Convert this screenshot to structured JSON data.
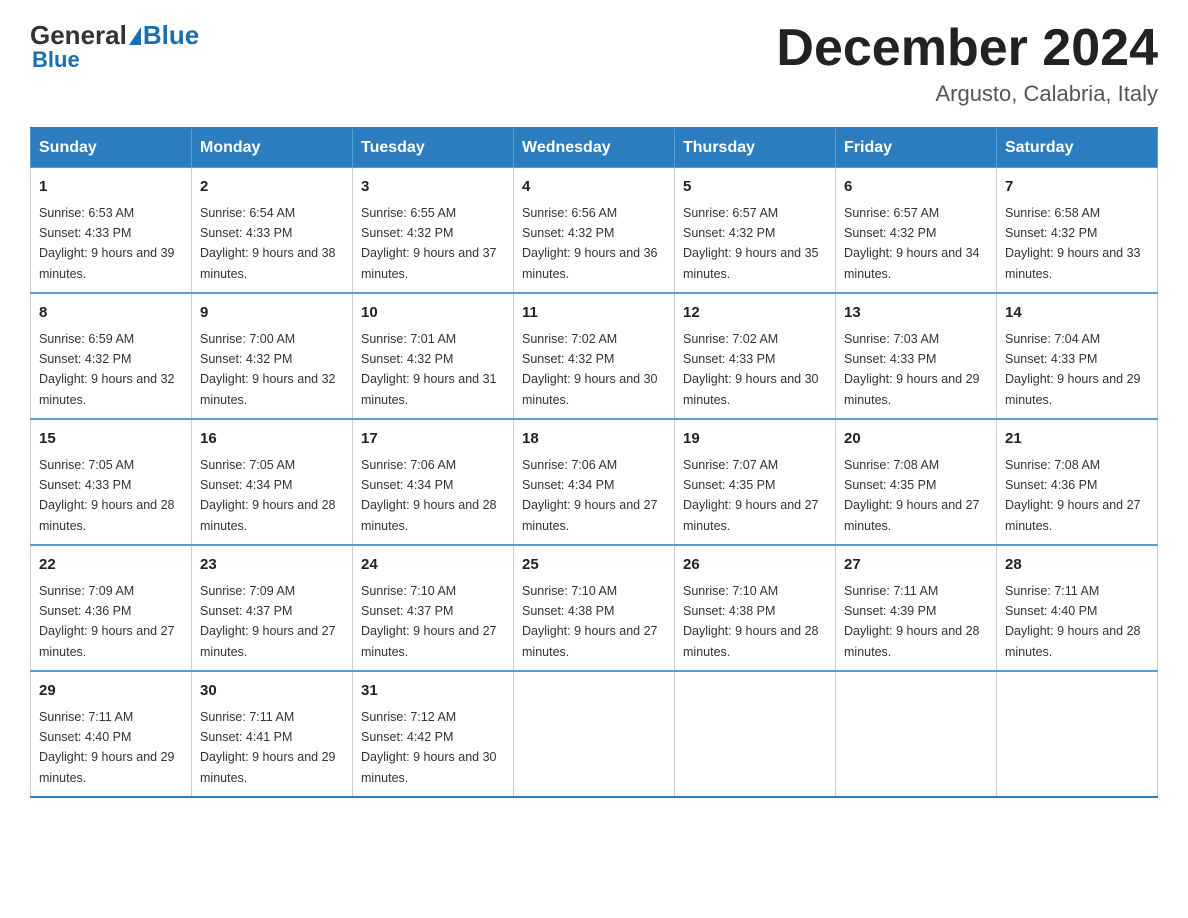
{
  "header": {
    "logo_general": "General",
    "logo_blue": "Blue",
    "month_title": "December 2024",
    "location": "Argusto, Calabria, Italy"
  },
  "days_of_week": [
    "Sunday",
    "Monday",
    "Tuesday",
    "Wednesday",
    "Thursday",
    "Friday",
    "Saturday"
  ],
  "weeks": [
    [
      {
        "day": "1",
        "sunrise": "6:53 AM",
        "sunset": "4:33 PM",
        "daylight": "9 hours and 39 minutes."
      },
      {
        "day": "2",
        "sunrise": "6:54 AM",
        "sunset": "4:33 PM",
        "daylight": "9 hours and 38 minutes."
      },
      {
        "day": "3",
        "sunrise": "6:55 AM",
        "sunset": "4:32 PM",
        "daylight": "9 hours and 37 minutes."
      },
      {
        "day": "4",
        "sunrise": "6:56 AM",
        "sunset": "4:32 PM",
        "daylight": "9 hours and 36 minutes."
      },
      {
        "day": "5",
        "sunrise": "6:57 AM",
        "sunset": "4:32 PM",
        "daylight": "9 hours and 35 minutes."
      },
      {
        "day": "6",
        "sunrise": "6:57 AM",
        "sunset": "4:32 PM",
        "daylight": "9 hours and 34 minutes."
      },
      {
        "day": "7",
        "sunrise": "6:58 AM",
        "sunset": "4:32 PM",
        "daylight": "9 hours and 33 minutes."
      }
    ],
    [
      {
        "day": "8",
        "sunrise": "6:59 AM",
        "sunset": "4:32 PM",
        "daylight": "9 hours and 32 minutes."
      },
      {
        "day": "9",
        "sunrise": "7:00 AM",
        "sunset": "4:32 PM",
        "daylight": "9 hours and 32 minutes."
      },
      {
        "day": "10",
        "sunrise": "7:01 AM",
        "sunset": "4:32 PM",
        "daylight": "9 hours and 31 minutes."
      },
      {
        "day": "11",
        "sunrise": "7:02 AM",
        "sunset": "4:32 PM",
        "daylight": "9 hours and 30 minutes."
      },
      {
        "day": "12",
        "sunrise": "7:02 AM",
        "sunset": "4:33 PM",
        "daylight": "9 hours and 30 minutes."
      },
      {
        "day": "13",
        "sunrise": "7:03 AM",
        "sunset": "4:33 PM",
        "daylight": "9 hours and 29 minutes."
      },
      {
        "day": "14",
        "sunrise": "7:04 AM",
        "sunset": "4:33 PM",
        "daylight": "9 hours and 29 minutes."
      }
    ],
    [
      {
        "day": "15",
        "sunrise": "7:05 AM",
        "sunset": "4:33 PM",
        "daylight": "9 hours and 28 minutes."
      },
      {
        "day": "16",
        "sunrise": "7:05 AM",
        "sunset": "4:34 PM",
        "daylight": "9 hours and 28 minutes."
      },
      {
        "day": "17",
        "sunrise": "7:06 AM",
        "sunset": "4:34 PM",
        "daylight": "9 hours and 28 minutes."
      },
      {
        "day": "18",
        "sunrise": "7:06 AM",
        "sunset": "4:34 PM",
        "daylight": "9 hours and 27 minutes."
      },
      {
        "day": "19",
        "sunrise": "7:07 AM",
        "sunset": "4:35 PM",
        "daylight": "9 hours and 27 minutes."
      },
      {
        "day": "20",
        "sunrise": "7:08 AM",
        "sunset": "4:35 PM",
        "daylight": "9 hours and 27 minutes."
      },
      {
        "day": "21",
        "sunrise": "7:08 AM",
        "sunset": "4:36 PM",
        "daylight": "9 hours and 27 minutes."
      }
    ],
    [
      {
        "day": "22",
        "sunrise": "7:09 AM",
        "sunset": "4:36 PM",
        "daylight": "9 hours and 27 minutes."
      },
      {
        "day": "23",
        "sunrise": "7:09 AM",
        "sunset": "4:37 PM",
        "daylight": "9 hours and 27 minutes."
      },
      {
        "day": "24",
        "sunrise": "7:10 AM",
        "sunset": "4:37 PM",
        "daylight": "9 hours and 27 minutes."
      },
      {
        "day": "25",
        "sunrise": "7:10 AM",
        "sunset": "4:38 PM",
        "daylight": "9 hours and 27 minutes."
      },
      {
        "day": "26",
        "sunrise": "7:10 AM",
        "sunset": "4:38 PM",
        "daylight": "9 hours and 28 minutes."
      },
      {
        "day": "27",
        "sunrise": "7:11 AM",
        "sunset": "4:39 PM",
        "daylight": "9 hours and 28 minutes."
      },
      {
        "day": "28",
        "sunrise": "7:11 AM",
        "sunset": "4:40 PM",
        "daylight": "9 hours and 28 minutes."
      }
    ],
    [
      {
        "day": "29",
        "sunrise": "7:11 AM",
        "sunset": "4:40 PM",
        "daylight": "9 hours and 29 minutes."
      },
      {
        "day": "30",
        "sunrise": "7:11 AM",
        "sunset": "4:41 PM",
        "daylight": "9 hours and 29 minutes."
      },
      {
        "day": "31",
        "sunrise": "7:12 AM",
        "sunset": "4:42 PM",
        "daylight": "9 hours and 30 minutes."
      },
      null,
      null,
      null,
      null
    ]
  ],
  "labels": {
    "sunrise": "Sunrise:",
    "sunset": "Sunset:",
    "daylight": "Daylight:"
  }
}
